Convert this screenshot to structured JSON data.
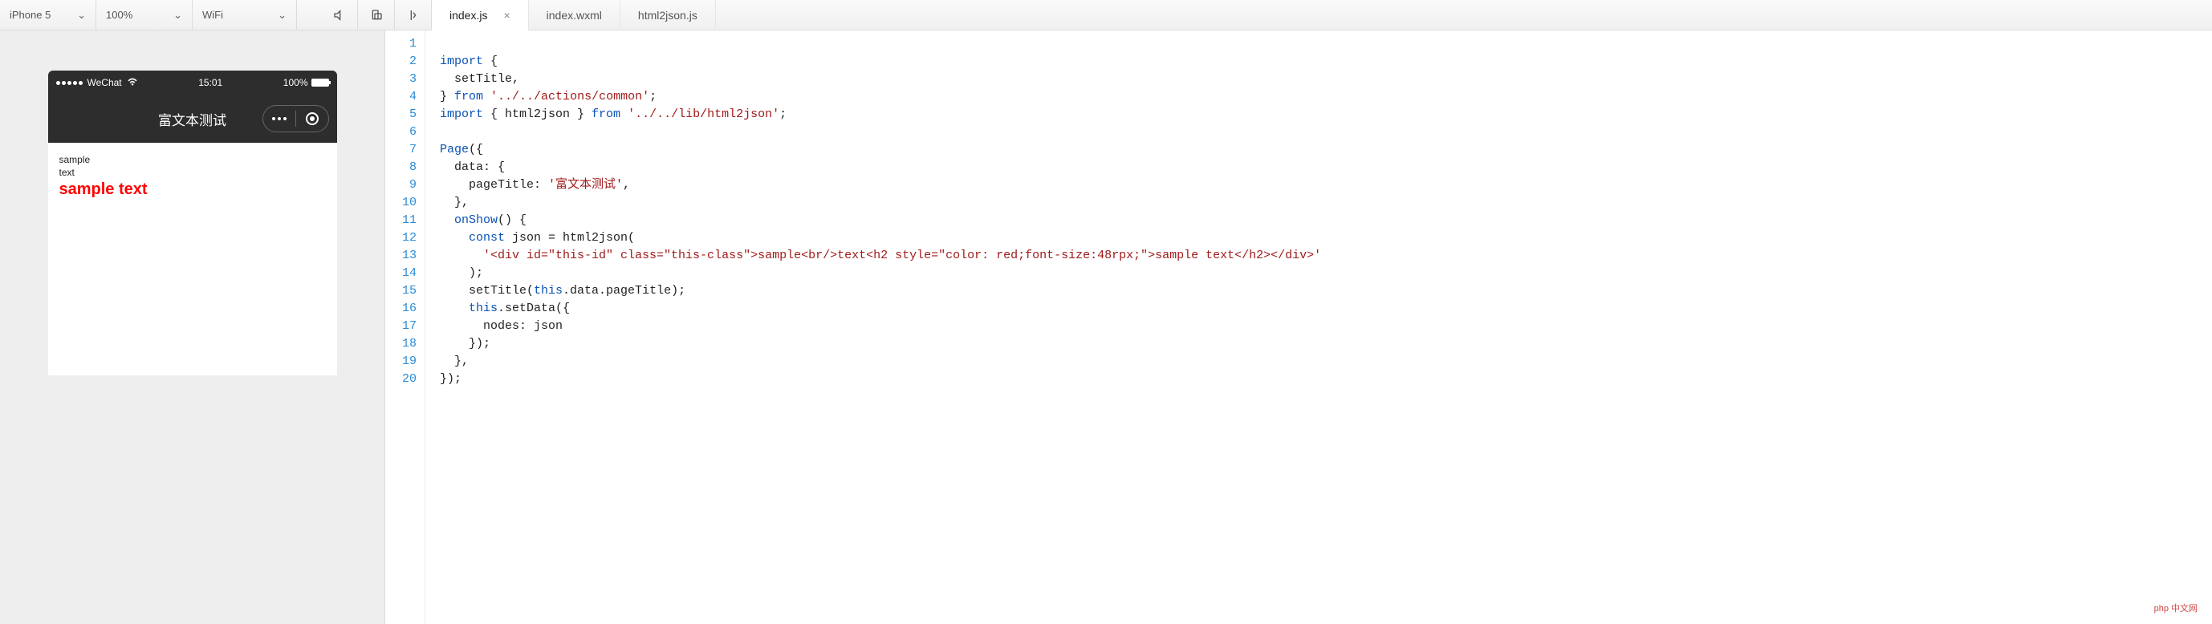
{
  "toolbar": {
    "device": "iPhone 5",
    "zoom": "100%",
    "network": "WiFi"
  },
  "tabs": [
    {
      "label": "index.js",
      "active": true,
      "closeable": true
    },
    {
      "label": "index.wxml",
      "active": false,
      "closeable": false
    },
    {
      "label": "html2json.js",
      "active": false,
      "closeable": false
    }
  ],
  "phone": {
    "carrier": "WeChat",
    "time": "15:01",
    "battery": "100%",
    "title": "富文本测试",
    "content": {
      "line1": "sample",
      "line2": "text",
      "big": "sample text"
    }
  },
  "code": {
    "lines": 20,
    "l1a": "import",
    "l1b": " {",
    "l2": "  setTitle,",
    "l3a": "} ",
    "l3b": "from",
    "l3c": " ",
    "l3d": "'../../actions/common'",
    "l3e": ";",
    "l4a": "import",
    "l4b": " { html2json } ",
    "l4c": "from",
    "l4d": " ",
    "l4e": "'../../lib/html2json'",
    "l4f": ";",
    "l5": "",
    "l6a": "Page",
    "l6b": "({",
    "l7": "  data: {",
    "l8a": "    pageTitle: ",
    "l8b": "'富文本测试'",
    "l8c": ",",
    "l9": "  },",
    "l10a": "  onShow",
    "l10b": "() {",
    "l11a": "    ",
    "l11b": "const",
    "l11c": " json = html2json(",
    "l12a": "      ",
    "l12b": "'<div id=\"this-id\" class=\"this-class\">sample<br/>text<h2 style=\"color: red;font-size:48rpx;\">sample text</h2></div>'",
    "l13": "    );",
    "l14a": "    setTitle(",
    "l14b": "this",
    "l14c": ".data.pageTitle);",
    "l15a": "    ",
    "l15b": "this",
    "l15c": ".setData({",
    "l16": "      nodes: json",
    "l17": "    });",
    "l18": "  },",
    "l19": "});",
    "l20": ""
  },
  "watermark": "php 中文网"
}
